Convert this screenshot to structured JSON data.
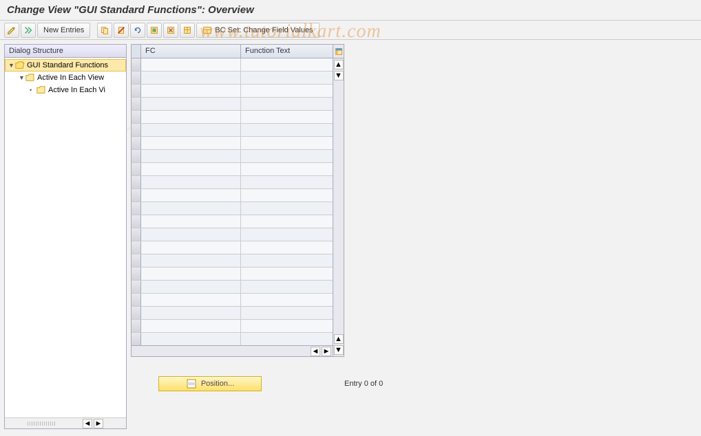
{
  "title": "Change View \"GUI Standard Functions\": Overview",
  "watermark": "www.tutorialkart.com",
  "toolbar": {
    "new_entries": "New Entries",
    "bc_set": "BC Set: Change Field Values"
  },
  "sidebar": {
    "header": "Dialog Structure",
    "items": [
      {
        "label": "GUI Standard Functions",
        "indent": 0,
        "open": true,
        "selected": true,
        "folderOpen": true
      },
      {
        "label": "Active In Each View",
        "indent": 1,
        "open": true,
        "selected": false,
        "folderOpen": false
      },
      {
        "label": "Active In Each Vi",
        "indent": 2,
        "open": false,
        "selected": false,
        "folderOpen": false,
        "leaf": true
      }
    ]
  },
  "grid": {
    "columns": {
      "fc": "FC",
      "ft": "Function Text"
    },
    "row_count": 22
  },
  "footer": {
    "position": "Position...",
    "entry": "Entry 0 of 0"
  }
}
